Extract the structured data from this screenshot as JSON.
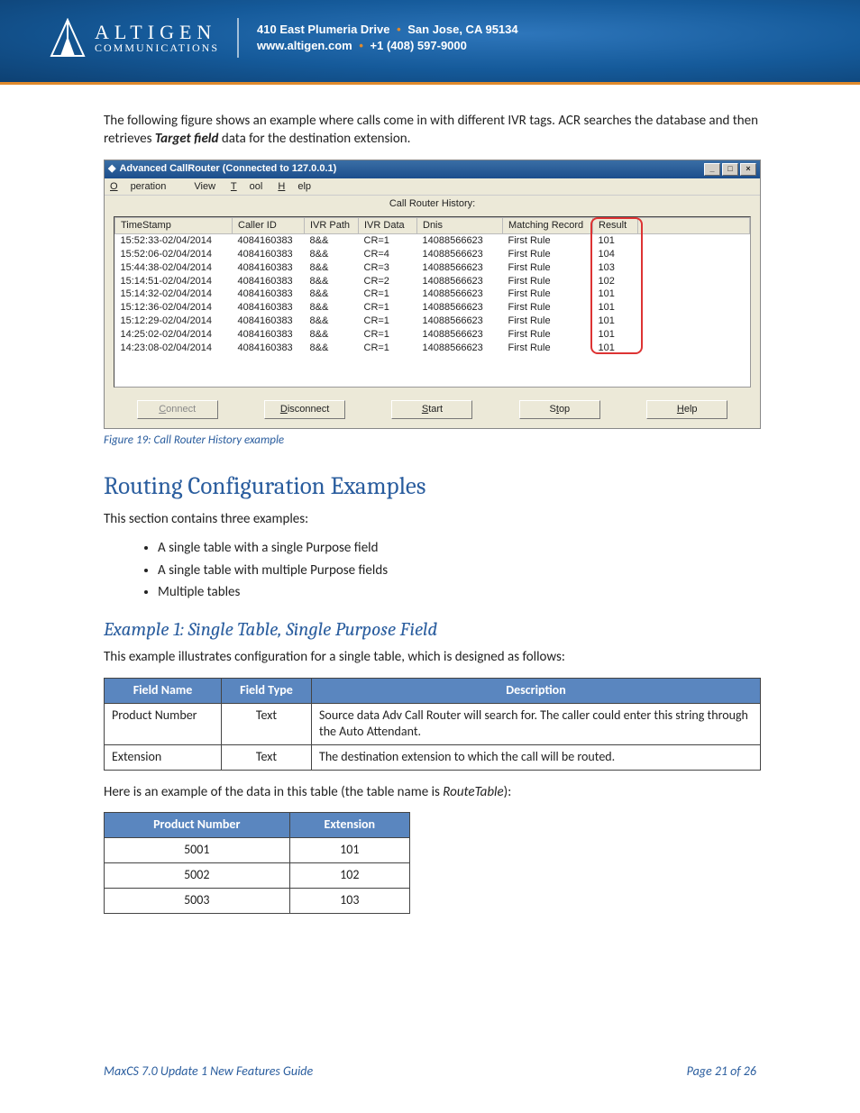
{
  "header": {
    "logo_main": "ALTIGEN",
    "logo_sub": "COMMUNICATIONS",
    "addr_line1_a": "410 East Plumeria Drive",
    "addr_line1_b": "San Jose, CA 95134",
    "addr_line2_a": "www.altigen.com",
    "addr_line2_b": "+1 (408) 597-9000"
  },
  "intro": {
    "p1_a": "The following figure shows an example where calls come in with different IVR tags. ACR searches the database and then retrieves ",
    "p1_em": "Target field",
    "p1_b": " data for the destination extension."
  },
  "win": {
    "title": "Advanced CallRouter (Connected to 127.0.0.1)",
    "menu": {
      "operation": "Operation",
      "view": "View",
      "tool": "Tool",
      "help": "Help"
    },
    "history_label": "Call Router History:",
    "cols": [
      "TimeStamp",
      "Caller ID",
      "IVR Path",
      "IVR Data",
      "Dnis",
      "Matching Record",
      "Result"
    ],
    "rows": [
      [
        "15:52:33-02/04/2014",
        "4084160383",
        "8&&",
        "CR=1",
        "14088566623",
        "First Rule",
        "101"
      ],
      [
        "15:52:06-02/04/2014",
        "4084160383",
        "8&&",
        "CR=4",
        "14088566623",
        "First Rule",
        "104"
      ],
      [
        "15:44:38-02/04/2014",
        "4084160383",
        "8&&",
        "CR=3",
        "14088566623",
        "First Rule",
        "103"
      ],
      [
        "15:14:51-02/04/2014",
        "4084160383",
        "8&&",
        "CR=2",
        "14088566623",
        "First Rule",
        "102"
      ],
      [
        "15:14:32-02/04/2014",
        "4084160383",
        "8&&",
        "CR=1",
        "14088566623",
        "First Rule",
        "101"
      ],
      [
        "15:12:36-02/04/2014",
        "4084160383",
        "8&&",
        "CR=1",
        "14088566623",
        "First Rule",
        "101"
      ],
      [
        "15:12:29-02/04/2014",
        "4084160383",
        "8&&",
        "CR=1",
        "14088566623",
        "First Rule",
        "101"
      ],
      [
        "14:25:02-02/04/2014",
        "4084160383",
        "8&&",
        "CR=1",
        "14088566623",
        "First Rule",
        "101"
      ],
      [
        "14:23:08-02/04/2014",
        "4084160383",
        "8&&",
        "CR=1",
        "14088566623",
        "First Rule",
        "101"
      ]
    ],
    "buttons": {
      "connect": "Connect",
      "disconnect": "Disconnect",
      "start": "Start",
      "stop": "Stop",
      "help": "Help"
    }
  },
  "caption": "Figure 19: Call Router History example",
  "section": {
    "h2": "Routing Configuration Examples",
    "intro": "This section contains three examples:",
    "bullets": [
      "A single table with a single Purpose field",
      "A single table with multiple Purpose fields",
      "Multiple tables"
    ],
    "ex1_h": "Example 1: Single Table, Single Purpose Field",
    "ex1_p": "This example illustrates configuration for a single table, which is designed as follows:"
  },
  "table1": {
    "headers": [
      "Field Name",
      "Field Type",
      "Description"
    ],
    "rows": [
      [
        "Product Number",
        "Text",
        "Source data Adv Call Router will search for. The caller could enter this string through the Auto Attendant."
      ],
      [
        "Extension",
        "Text",
        "The destination extension to which the call will be routed."
      ]
    ]
  },
  "table2_intro_a": "Here is an example of the data in this table (the table name is ",
  "table2_intro_em": "RouteTable",
  "table2_intro_b": "):",
  "table2": {
    "headers": [
      "Product Number",
      "Extension"
    ],
    "rows": [
      [
        "5001",
        "101"
      ],
      [
        "5002",
        "102"
      ],
      [
        "5003",
        "103"
      ]
    ]
  },
  "footer": {
    "left": "MaxCS 7.0 Update 1 New Features Guide",
    "right": "Page 21 of 26"
  }
}
